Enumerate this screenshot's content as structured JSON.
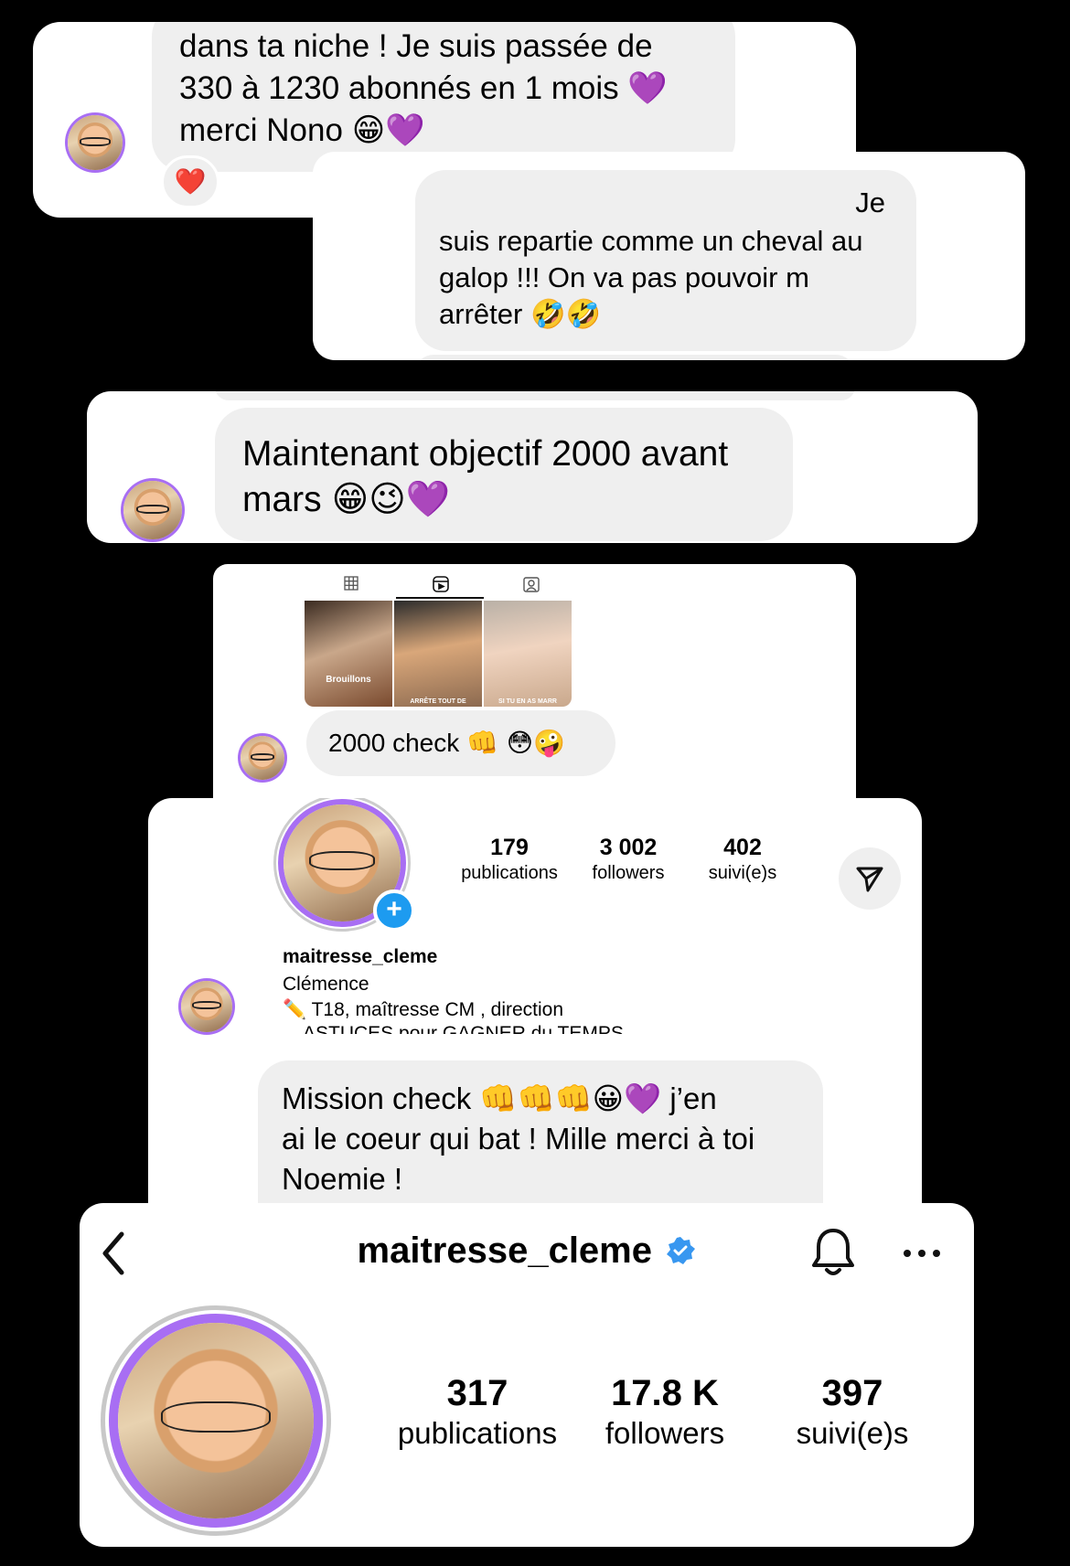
{
  "card1": {
    "message": "dans ta niche ! Je suis passée de 330 à 1230 abonnés en 1 mois 💜 merci Nono 😁💜",
    "line1": "dans ta niche ! Je suis passée de",
    "line2": "330 à 1230 abonnés en 1 mois",
    "line2_emoji": "💜",
    "line3": "merci Nono",
    "line3_emoji": "😁💜",
    "reaction": "❤️"
  },
  "card2": {
    "line0": "Je",
    "line1": "suis repartie comme un cheval au",
    "line2": "galop !!! On va pas pouvoir m",
    "line3": "arrêter",
    "line3_emoji": "🤣🤣"
  },
  "card3": {
    "line1": "Maintenant objectif 2000 avant",
    "line2": "mars",
    "line2_emoji": "😁😉💜"
  },
  "card4": {
    "thumbs": [
      {
        "label": "Brouillons",
        "caption": ""
      },
      {
        "label": "",
        "caption": "ARRÊTE TOUT DE"
      },
      {
        "label": "",
        "caption": "SI TU EN AS MARR"
      }
    ],
    "message": "2000 check",
    "message_emoji": "👊 😳🤪"
  },
  "card5": {
    "stats": [
      {
        "num": "179",
        "label": "publications"
      },
      {
        "num": "3 002",
        "label": "followers"
      },
      {
        "num": "402",
        "label": "suivi(e)s"
      }
    ],
    "username": "maitresse_cleme",
    "name": "Clémence",
    "bio1": "✏️ T18, maîtresse CM , direction",
    "bio2": "ASTUCES pour GAGNER du TEMPS",
    "msg_line1": "Mission check",
    "msg_line1_emoji": "👊👊👊😀💜",
    "msg_line1_end": "j’en",
    "msg_line2": "ai le coeur qui bat ! Mille merci à toi",
    "msg_line3": "Noemie !"
  },
  "card6": {
    "username": "maitresse_cleme",
    "stats": [
      {
        "num": "317",
        "label": "publications"
      },
      {
        "num": "17.8 K",
        "label": "followers"
      },
      {
        "num": "397",
        "label": "suivi(e)s"
      }
    ]
  },
  "icons": [
    "back-chevron-icon",
    "verified-badge-icon",
    "bell-icon",
    "more-icon",
    "send-icon",
    "grid-icon",
    "reels-icon",
    "tagged-icon",
    "plus-icon"
  ],
  "colors": {
    "accent_purple": "#a86ef3",
    "verified_blue": "#3897f0",
    "bubble_grey": "#efefef"
  }
}
